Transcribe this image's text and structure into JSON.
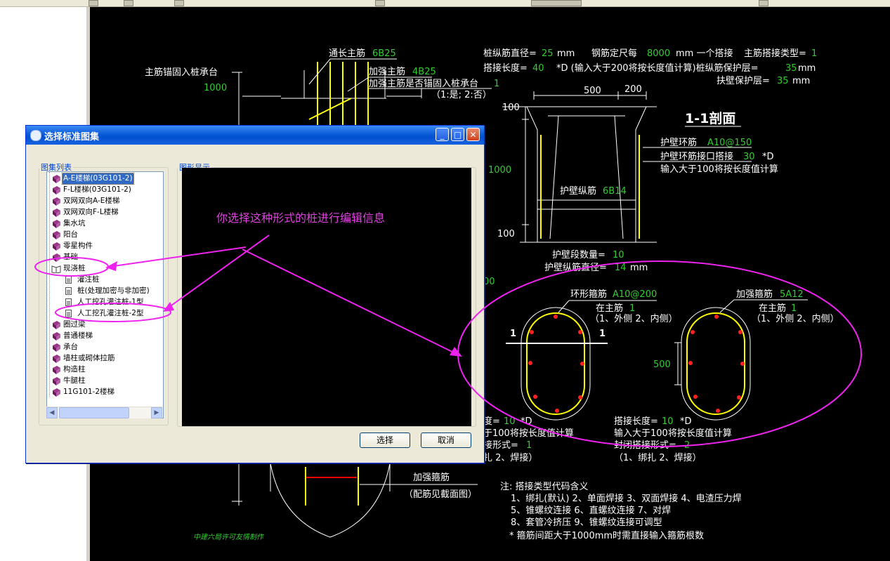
{
  "dialog": {
    "title": "选择标准图集",
    "list_legend": "图集列表",
    "preview_legend": "图形显示",
    "select_button": "选择",
    "cancel_button": "取消",
    "tree_items": [
      {
        "label": "A-E楼梯(03G101-2)",
        "type": "book",
        "level": 0,
        "selected": true
      },
      {
        "label": "F-L楼梯(03G101-2)",
        "type": "book",
        "level": 0
      },
      {
        "label": "双网双向A-E楼梯",
        "type": "book",
        "level": 0
      },
      {
        "label": "双网双向F-L楼梯",
        "type": "book",
        "level": 0
      },
      {
        "label": "集水坑",
        "type": "book",
        "level": 0
      },
      {
        "label": "阳台",
        "type": "book",
        "level": 0
      },
      {
        "label": "零星构件",
        "type": "book",
        "level": 0
      },
      {
        "label": "基础",
        "type": "book",
        "level": 0
      },
      {
        "label": "现浇桩",
        "type": "openbook",
        "level": 0
      },
      {
        "label": "灌注桩",
        "type": "doc",
        "level": 1
      },
      {
        "label": "桩(处理加密与非加密)",
        "type": "doc",
        "level": 1
      },
      {
        "label": "人工挖孔灌注桩-1型",
        "type": "doc",
        "level": 1
      },
      {
        "label": "人工挖孔灌注桩-2型",
        "type": "doc",
        "level": 1
      },
      {
        "label": "圈过梁",
        "type": "book",
        "level": 0
      },
      {
        "label": "普通楼梯",
        "type": "book",
        "level": 0
      },
      {
        "label": "承台",
        "type": "book",
        "level": 0
      },
      {
        "label": "墙柱或砌体拉筋",
        "type": "book",
        "level": 0
      },
      {
        "label": "构造柱",
        "type": "book",
        "level": 0
      },
      {
        "label": "牛腿柱",
        "type": "book",
        "level": 0
      },
      {
        "label": "11G101-2楼梯",
        "type": "book",
        "level": 0
      }
    ]
  },
  "annotation": "你选择这种形式的桩进行编辑信息",
  "cad": {
    "t1": "通长主筋",
    "t1v": "6B25",
    "t2": "主筋锚固入桩承台",
    "t2v": "1000",
    "t3": "加强主筋",
    "t3v": "4B25",
    "t4": "加强主筋是否锚固入桩承台",
    "t4v": "1",
    "t5": "（1:是; 2:否）",
    "t6": "桩纵筋直径=",
    "t6v": "25",
    "t6u": "mm",
    "t7": "钢筋定尺每",
    "t7v": "8000",
    "t7u": "mm 一个搭接",
    "t8": "主筋搭接类型=",
    "t8v": "1",
    "t9": "搭接长度=",
    "t9v": "40",
    "t9u": "*D (输入大于200将按长度值计算)桩纵筋保护层=",
    "t9v2": "35",
    "t9u2": "mm",
    "t10": "扶壁保护层=",
    "t10v": "35",
    "t10u": "mm",
    "d500": "500",
    "d200": "200",
    "d100a": "100",
    "d1000": "1000",
    "d100b": "100",
    "section": "1-1剖面",
    "hb1": "护壁环筋",
    "hb1v": "A10@150",
    "hb2": "护壁环筋接口搭接",
    "hb2v": "30",
    "hb2u": "*D",
    "hb3": "输入大于100将按长度值计算",
    "hb4": "护壁纵筋",
    "hb4v": "6B14",
    "hb5": "护壁段数量=",
    "hb5v": "10",
    "hb6": "护壁纵筋直径=",
    "hb6v": "14",
    "hb6u": "mm",
    "d200left": "00",
    "r1": "环形箍筋",
    "r1v": "A10@200",
    "r2": "在主筋",
    "r2v": "1",
    "r3": "（1、外侧  2、内侧）",
    "r4": "加强箍筋",
    "r4v": "5A12",
    "r5": "在主筋",
    "r5v": "1",
    "r6": "（1、外侧  2、内侧）",
    "one": "1",
    "d500b": "500",
    "l1": "度=",
    "l1v": "10",
    "l1u": "*D",
    "l2": "于100将按长度值计算",
    "l3": "接形式=",
    "l3v": "1",
    "l4": "扎  2、焊接）",
    "l5": "搭接长度=",
    "l5v": "10",
    "l5u": "*D",
    "l6": "输入大于100将按长度值计算",
    "l7": "封闭搭接形式=",
    "l7v": "2",
    "l8": "（1、绑扎  2、焊接）",
    "jq1": "加强箍筋",
    "jq2": "（配筋见截面图）",
    "n0": "注: 搭接类型代码含义",
    "n1": "1、绑扎(默认)   2、单面焊接   3、双面焊接   4、电渣压力焊",
    "n2": "5、锥螺纹连接   6、直螺纹连接   7、对焊",
    "n3": "8、套管冷挤压   9、锥螺纹连接可调型",
    "n4": "* 箍筋间距大于1000mm时需直接输入箍筋根数",
    "credit": "中建六局许可友情制作"
  }
}
